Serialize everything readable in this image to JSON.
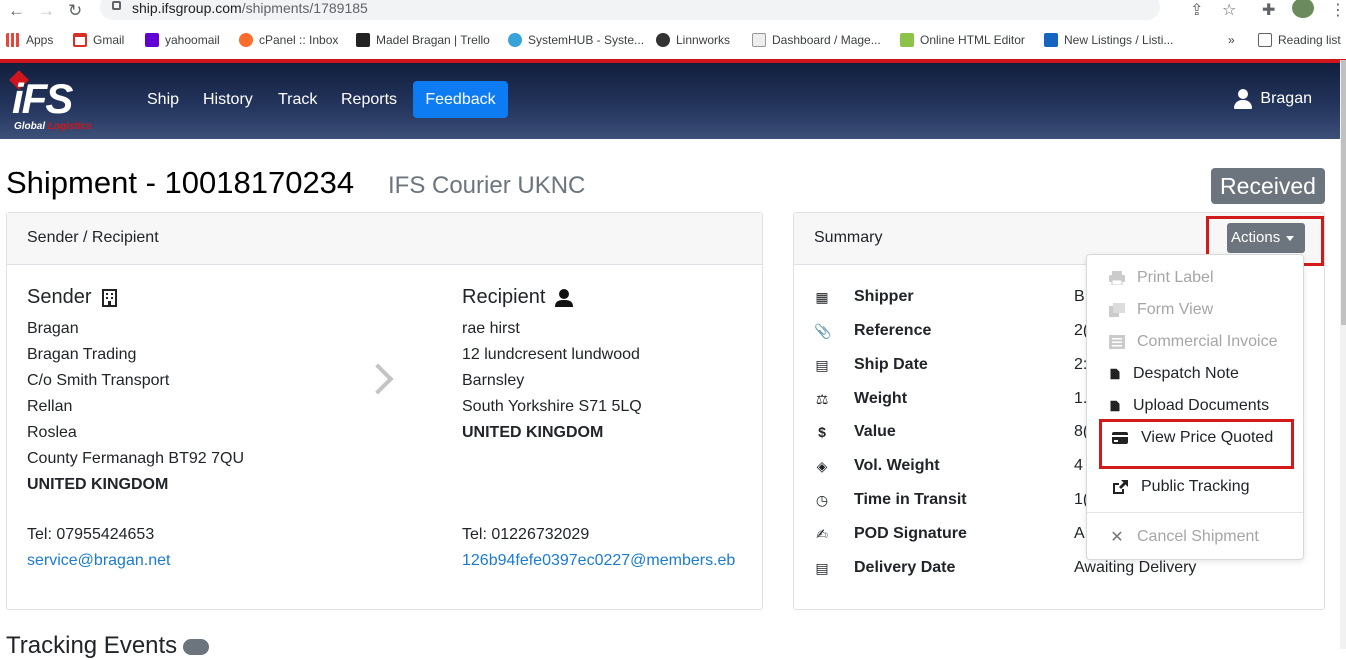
{
  "browser": {
    "url_host": "ship.ifsgroup.com",
    "url_path": "/shipments/1789185",
    "bookmarks": [
      "Apps",
      "Gmail",
      "yahoomail",
      "cPanel :: Inbox",
      "Madel Bragan | Trello",
      "SystemHUB - Syste...",
      "Linnworks",
      "Dashboard / Mage...",
      "Online HTML Editor",
      "New Listings / Listi..."
    ],
    "more": "»",
    "reading_list": "Reading list"
  },
  "navbar": {
    "logo_text": "iFS",
    "logo_sub1": "Global",
    "logo_sub2": "Logistics",
    "links": [
      "Ship",
      "History",
      "Track",
      "Reports"
    ],
    "feedback": "Feedback",
    "user": "Bragan"
  },
  "page": {
    "title": "Shipment - 10018170234",
    "carrier": "IFS Courier UKNC",
    "status": "Received"
  },
  "sender_recipient": {
    "header": "Sender / Recipient",
    "sender": {
      "title": "Sender",
      "lines": [
        "Bragan",
        "Bragan Trading",
        "C/o Smith Transport",
        "Rellan",
        "Roslea",
        "County Fermanagh BT92 7QU"
      ],
      "country": "UNITED KINGDOM",
      "tel": "Tel: 07955424653",
      "email": "service@bragan.net"
    },
    "recipient": {
      "title": "Recipient",
      "lines": [
        "rae hirst",
        "12 lundcresent lundwood",
        "Barnsley",
        "South Yorkshire S71 5LQ"
      ],
      "country": "UNITED KINGDOM",
      "tel": "Tel: 01226732029",
      "email": "126b94fefe0397ec0227@members.eb"
    }
  },
  "summary": {
    "header": "Summary",
    "actions_label": "Actions",
    "rows": [
      {
        "label": "Shipper",
        "value": "B"
      },
      {
        "label": "Reference",
        "value": "2("
      },
      {
        "label": "Ship Date",
        "value": "2:"
      },
      {
        "label": "Weight",
        "value": "1."
      },
      {
        "label": "Value",
        "value": "8("
      },
      {
        "label": "Vol. Weight",
        "value": "4"
      },
      {
        "label": "Time in Transit",
        "value": "1("
      },
      {
        "label": "POD Signature",
        "value": "A"
      },
      {
        "label": "Delivery Date",
        "value": "Awaiting Delivery"
      }
    ]
  },
  "actions_menu": {
    "items": [
      {
        "label": "Print Label",
        "enabled": false
      },
      {
        "label": "Form View",
        "enabled": false
      },
      {
        "label": "Commercial Invoice",
        "enabled": false
      },
      {
        "label": "Despatch Note",
        "enabled": true
      },
      {
        "label": "Upload Documents",
        "enabled": true
      },
      {
        "label": "View Price Quoted",
        "enabled": true
      },
      {
        "label": "Public Tracking",
        "enabled": true
      },
      {
        "label": "Cancel Shipment",
        "enabled": false
      }
    ]
  },
  "tracking": {
    "title": "Tracking Events"
  }
}
